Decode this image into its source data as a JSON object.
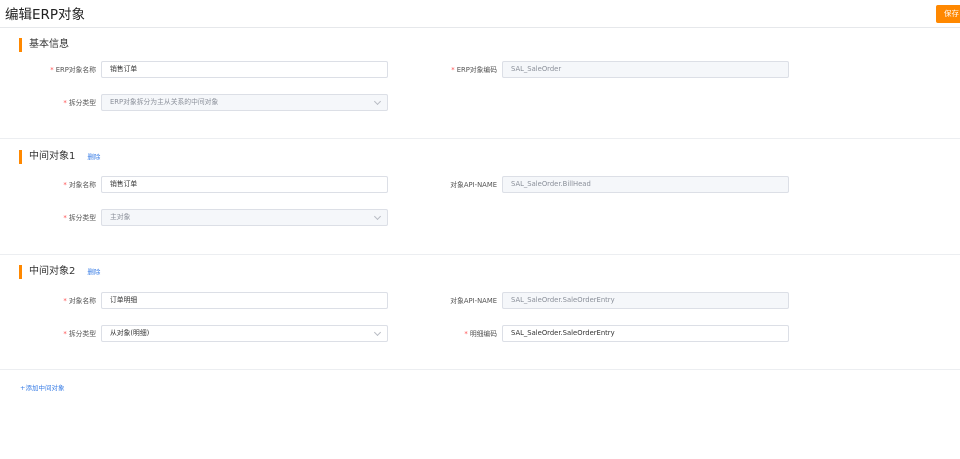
{
  "header": {
    "title": "编辑ERP对象",
    "save_label": "保存"
  },
  "basic": {
    "title": "基本信息",
    "erp_name_label": "ERP对象名称",
    "erp_name_value": "销售订单",
    "erp_code_label": "ERP对象编码",
    "erp_code_value": "SAL_SaleOrder",
    "split_type_label": "拆分类型",
    "split_type_value": "ERP对象拆分为主从关系的中间对象"
  },
  "middle1": {
    "title": "中间对象1",
    "delete_label": "删除",
    "name_label": "对象名称",
    "name_value": "销售订单",
    "api_label": "对象API-NAME",
    "api_value": "SAL_SaleOrder.BillHead",
    "split_type_label": "拆分类型",
    "split_type_value": "主对象"
  },
  "middle2": {
    "title": "中间对象2",
    "delete_label": "删除",
    "name_label": "对象名称",
    "name_value": "订单明细",
    "api_label": "对象API-NAME",
    "api_value": "SAL_SaleOrder.SaleOrderEntry",
    "split_type_label": "拆分类型",
    "split_type_value": "从对象(明细)",
    "detail_code_label": "明细编码",
    "detail_code_value": "SAL_SaleOrder.SaleOrderEntry"
  },
  "add_middle_label": "+添加中间对象",
  "colors": {
    "accent": "#ff8800",
    "link": "#3a7ee6",
    "required": "#ff4d4f"
  }
}
